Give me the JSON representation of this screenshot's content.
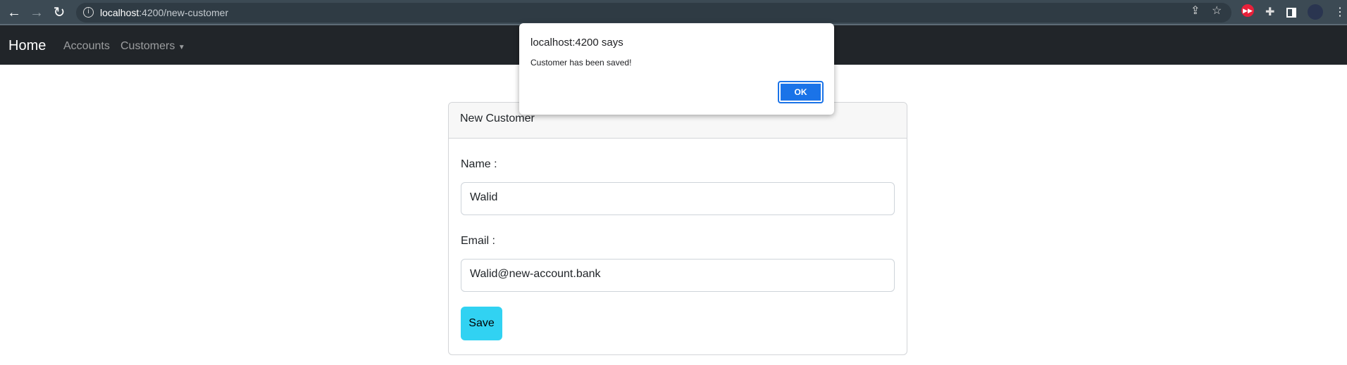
{
  "browser": {
    "url_host": "localhost",
    "url_path": ":4200/new-customer"
  },
  "navbar": {
    "brand": "Home",
    "items": [
      "Accounts",
      "Customers"
    ]
  },
  "card": {
    "title": "New Customer",
    "name_label": "Name :",
    "name_value": "Walid",
    "email_label": "Email :",
    "email_value": "Walid@new-account.bank",
    "save_label": "Save"
  },
  "dialog": {
    "title": "localhost:4200 says",
    "message": "Customer has been saved!",
    "ok_label": "OK"
  }
}
